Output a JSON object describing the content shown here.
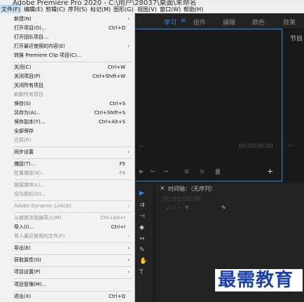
{
  "window": {
    "title": "Adobe Premiere Pro 2020 - C:\\用户\\28037\\桌面\\未命名"
  },
  "menubar": [
    "文件(F)",
    "编辑(E)",
    "剪辑(C)",
    "序列(S)",
    "标记(M)",
    "图形(G)",
    "视图(V)",
    "窗口(W)",
    "帮助(H)"
  ],
  "workspace": {
    "tabs": [
      "学习",
      "组件",
      "编辑",
      "颜色",
      "效果"
    ]
  },
  "file_menu": {
    "items": [
      {
        "label": "新建(N)",
        "shortcut": "",
        "submenu": true,
        "disabled": false
      },
      {
        "label": "打开项目(O)...",
        "shortcut": "Ctrl+O",
        "submenu": false,
        "disabled": false
      },
      {
        "label": "打开团队项目...",
        "shortcut": "",
        "submenu": false,
        "disabled": false
      },
      {
        "label": "打开最近使用的内容(E)",
        "shortcut": "",
        "submenu": true,
        "disabled": false
      },
      {
        "label": "转换 Premiere Clip 项目(C)...",
        "shortcut": "",
        "submenu": false,
        "disabled": false
      },
      {
        "label": "关闭(C)",
        "shortcut": "Ctrl+W",
        "submenu": false,
        "disabled": false
      },
      {
        "label": "关闭项目(P)",
        "shortcut": "Ctrl+Shift+W",
        "submenu": false,
        "disabled": false
      },
      {
        "label": "关闭所有项目",
        "shortcut": "",
        "submenu": false,
        "disabled": false
      },
      {
        "label": "刷新所有项目",
        "shortcut": "",
        "submenu": false,
        "disabled": true
      },
      {
        "label": "保存(S)",
        "shortcut": "Ctrl+S",
        "submenu": false,
        "disabled": false
      },
      {
        "label": "另存为(A)...",
        "shortcut": "Ctrl+Shift+S",
        "submenu": false,
        "disabled": false
      },
      {
        "label": "保存副本(Y)...",
        "shortcut": "Ctrl+Alt+S",
        "submenu": false,
        "disabled": false
      },
      {
        "label": "全部保存",
        "shortcut": "",
        "submenu": false,
        "disabled": false
      },
      {
        "label": "还原(R)",
        "shortcut": "",
        "submenu": false,
        "disabled": true
      },
      {
        "label": "同步设置",
        "shortcut": "",
        "submenu": true,
        "disabled": false
      },
      {
        "label": "捕捉(T)...",
        "shortcut": "F5",
        "submenu": false,
        "disabled": false
      },
      {
        "label": "批量捕捉(B)...",
        "shortcut": "F6",
        "submenu": false,
        "disabled": true
      },
      {
        "label": "链接媒体(L)...",
        "shortcut": "",
        "submenu": false,
        "disabled": true
      },
      {
        "label": "设为脱机(O)...",
        "shortcut": "",
        "submenu": false,
        "disabled": true
      },
      {
        "label": "Adobe Dynamic Link(K)",
        "shortcut": "",
        "submenu": true,
        "disabled": true
      },
      {
        "label": "从媒体浏览器导入(M)",
        "shortcut": "Ctrl+Alt+I",
        "submenu": false,
        "disabled": true
      },
      {
        "label": "导入(I)...",
        "shortcut": "Ctrl+I",
        "submenu": false,
        "disabled": false
      },
      {
        "label": "导入最近使用的文件(F)",
        "shortcut": "",
        "submenu": true,
        "disabled": true
      },
      {
        "label": "导出(E)",
        "shortcut": "",
        "submenu": true,
        "disabled": false
      },
      {
        "label": "获取属性(G)",
        "shortcut": "",
        "submenu": true,
        "disabled": false
      },
      {
        "label": "项目设置(P)",
        "shortcut": "",
        "submenu": true,
        "disabled": false
      },
      {
        "label": "项目管理(M)...",
        "shortcut": "",
        "submenu": false,
        "disabled": false
      },
      {
        "label": "退出(X)",
        "shortcut": "Ctrl+Q",
        "submenu": false,
        "disabled": false
      }
    ]
  },
  "program_panel": {
    "title": "节目"
  },
  "source_monitor": {
    "timecode": "00;00;00;00"
  },
  "timeline": {
    "title": "时间轴：（无序列）",
    "timecode": "00;00;00;00"
  },
  "tools": [
    "selection-tool",
    "track-select-tool",
    "ripple-edit-tool",
    "razor-tool",
    "slip-tool",
    "pen-tool",
    "hand-tool",
    "type-tool"
  ],
  "logo": {
    "text": "最需教育"
  },
  "colors": {
    "accent": "#2d8ceb",
    "menu_bg": "#f2f2f2",
    "app_bg": "#1d1d1d",
    "logo_text": "#1a3fae"
  }
}
